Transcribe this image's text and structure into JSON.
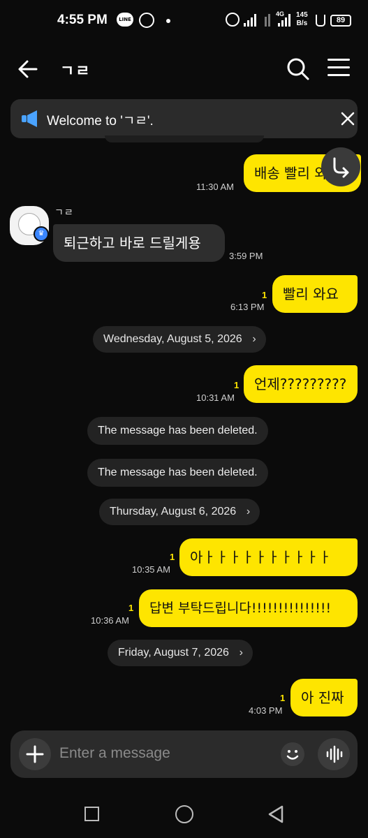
{
  "status_bar": {
    "time": "4:55 PM",
    "network_speed": "145",
    "network_unit": "B/s",
    "network_type": "4G",
    "battery": "89"
  },
  "header": {
    "title": "ㄱㄹ"
  },
  "notice": {
    "text": "Welcome to 'ㄱㄹ'."
  },
  "messages": [
    {
      "type": "mine",
      "text": "배송 빨리 와요",
      "time": "11:30 AM",
      "read": ""
    },
    {
      "type": "theirs",
      "sender": "ㄱㄹ",
      "text": "퇴근하고 바로 드릴게용",
      "time": "3:59 PM"
    },
    {
      "type": "mine",
      "text": "빨리 와요",
      "time": "6:13 PM",
      "read": "1"
    },
    {
      "type": "date",
      "text": "Wednesday, August 5, 2026"
    },
    {
      "type": "mine",
      "text": "언제?????????",
      "time": "10:31 AM",
      "read": "1"
    },
    {
      "type": "deleted",
      "text": "The message has been deleted."
    },
    {
      "type": "deleted",
      "text": "The message has been deleted."
    },
    {
      "type": "date",
      "text": "Thursday, August 6, 2026"
    },
    {
      "type": "mine",
      "text": "아ㅏㅏㅏㅏㅏㅏㅏㅏㅏㅏ",
      "time": "10:35 AM",
      "read": "1"
    },
    {
      "type": "mine",
      "text": "답변 부탁드립니다!!!!!!!!!!!!!!!",
      "time": "10:36 AM",
      "read": "1"
    },
    {
      "type": "date",
      "text": "Friday, August 7, 2026"
    },
    {
      "type": "mine",
      "text": "아 진짜",
      "time": "4:03 PM",
      "read": "1"
    }
  ],
  "input": {
    "placeholder": "Enter a message"
  },
  "colors": {
    "background": "#0b0b0b",
    "my_bubble": "#fee500",
    "their_bubble": "#2e2e2e",
    "read_count": "#fee500"
  }
}
